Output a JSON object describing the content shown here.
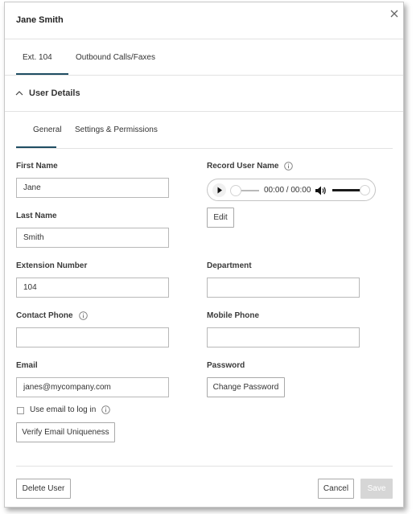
{
  "dialog": {
    "title": "Jane Smith",
    "close_icon": "close-icon"
  },
  "top_tabs": [
    {
      "label": "Ext. 104",
      "active": true
    },
    {
      "label": "Outbound Calls/Faxes",
      "active": false
    }
  ],
  "section": {
    "label": "User Details",
    "expanded": true,
    "icon": "chevron-up-icon"
  },
  "sub_tabs": [
    {
      "label": "General",
      "active": true
    },
    {
      "label": "Settings & Permissions",
      "active": false
    }
  ],
  "form": {
    "first_name": {
      "label": "First Name",
      "value": "Jane"
    },
    "last_name": {
      "label": "Last Name",
      "value": "Smith"
    },
    "extension_number": {
      "label": "Extension Number",
      "value": "104"
    },
    "contact_phone": {
      "label": "Contact Phone",
      "value": "",
      "info_icon": "info-icon"
    },
    "email": {
      "label": "Email",
      "value": "janes@mycompany.com"
    },
    "use_email_login": {
      "label": "Use email to log in",
      "checked": false,
      "info_icon": "info-icon"
    },
    "verify_email_button": "Verify Email Uniqueness",
    "record_user_name": {
      "label": "Record User Name",
      "info_icon": "info-icon"
    },
    "department": {
      "label": "Department",
      "value": ""
    },
    "mobile_phone": {
      "label": "Mobile Phone",
      "value": ""
    },
    "password": {
      "label": "Password",
      "change_button": "Change Password"
    },
    "edit_button": "Edit"
  },
  "audio_player": {
    "time": "00:00 / 00:00",
    "play_icon": "play-icon",
    "volume_icon": "volume-icon",
    "progress": 0,
    "volume": 0.85
  },
  "footer": {
    "delete_button": "Delete User",
    "cancel_button": "Cancel",
    "save_button": "Save",
    "save_enabled": false
  },
  "colors": {
    "accent": "#1f4e63",
    "border": "#b8b8b8",
    "disabled": "#d6d6d6"
  }
}
